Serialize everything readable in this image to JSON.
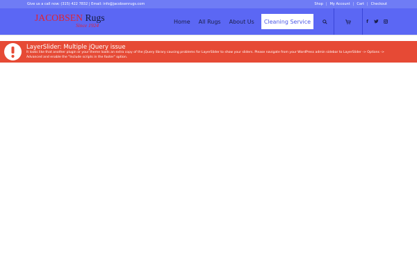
{
  "topbar": {
    "contact": "Give us a call now: (315) 422 7832  |  Email: info@jacobsenrugs.com",
    "links": [
      {
        "label": "Shop"
      },
      {
        "label": "My Account"
      },
      {
        "label": "Cart"
      },
      {
        "label": "Checkout"
      }
    ]
  },
  "logo": {
    "brand_red": "JACOBSEN",
    "brand_dark": "Rugs",
    "since": "Since 1924"
  },
  "nav": {
    "items": [
      {
        "label": "Home"
      },
      {
        "label": "All Rugs"
      },
      {
        "label": "About Us"
      },
      {
        "label": "Cleaning Service",
        "active": true
      }
    ],
    "search_icon": "search-icon",
    "cart_icon": "shopping-cart-icon"
  },
  "social": {
    "items": [
      {
        "icon": "facebook-icon",
        "glyph": "f"
      },
      {
        "icon": "twitter-icon",
        "glyph": "t"
      },
      {
        "icon": "instagram-icon",
        "glyph": "◘"
      }
    ]
  },
  "alert": {
    "icon": "exclamation-icon",
    "title": "LayerSlider: Multiple jQuery issue",
    "message": "It looks like that another plugin or your theme loads an extra copy of the jQuery library causing problems for LayerSlider to show your sliders. Please navigate from your WordPress admin sidebar to LayerSlider -> Options -> Advanced and enable the \"Include scripts in the footer\" option."
  },
  "colors": {
    "topbar_bg": "#6f7cf5",
    "header_bg": "#5b67f4",
    "alert_bg": "#e64a35",
    "brand_red": "#e32230",
    "nav_text": "#1b1f4a"
  }
}
